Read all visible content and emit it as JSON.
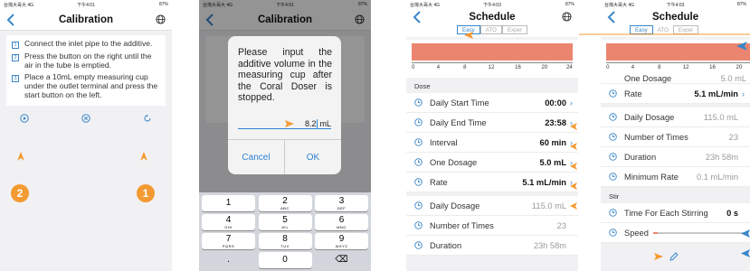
{
  "status": {
    "carrier": "台灣大哥大 4G",
    "battery": "87%"
  },
  "phone1": {
    "time": "下午4:01",
    "title": "Calibration",
    "steps": [
      {
        "num": "1",
        "text": "Connect the inlet pipe to the additive."
      },
      {
        "num": "2",
        "text": "Press the button on the right until the air in the tube is emptied."
      },
      {
        "num": "3",
        "text": "Place a 10mL empty measuring cup under the outlet terminal and press the start button on the left."
      }
    ],
    "badge_left": "2",
    "badge_right": "1"
  },
  "phone2": {
    "time": "下午4:01",
    "title": "Calibration",
    "dialog_text": "Please input the additive volume in the measuring cup after the Coral Doser is stopped.",
    "input_value": "8.2",
    "input_unit": "mL",
    "cancel": "Cancel",
    "ok": "OK",
    "keys": [
      [
        {
          "d": "1",
          "l": ""
        },
        {
          "d": "2",
          "l": "ABC"
        },
        {
          "d": "3",
          "l": "DEF"
        }
      ],
      [
        {
          "d": "4",
          "l": "GHI"
        },
        {
          "d": "5",
          "l": "JKL"
        },
        {
          "d": "6",
          "l": "MNO"
        }
      ],
      [
        {
          "d": "7",
          "l": "PQRS"
        },
        {
          "d": "8",
          "l": "TUV"
        },
        {
          "d": "9",
          "l": "WXYZ"
        }
      ],
      [
        {
          "d": ".",
          "l": ""
        },
        {
          "d": "0",
          "l": ""
        },
        {
          "d": "⌫",
          "l": ""
        }
      ]
    ]
  },
  "phone3": {
    "time": "下午4:03",
    "title": "Schedule",
    "tabs": [
      "Easy",
      "ATO",
      "Exper"
    ],
    "axis": [
      "0",
      "4",
      "8",
      "12",
      "16",
      "20",
      "24"
    ],
    "section": "Dose",
    "rows": [
      {
        "label": "Daily Start Time",
        "value": "00:00"
      },
      {
        "label": "Daily End Time",
        "value": "23:58"
      },
      {
        "label": "Interval",
        "value": "60 min"
      },
      {
        "label": "One Dosage",
        "value": "5.0 mL"
      },
      {
        "label": "Rate",
        "value": "5.1 mL/min"
      }
    ],
    "ro_rows": [
      {
        "label": "Daily Dosage",
        "value": "115.0 mL"
      },
      {
        "label": "Number of Times",
        "value": "23"
      },
      {
        "label": "Duration",
        "value": "23h 58m"
      }
    ]
  },
  "phone4": {
    "time": "下午4:03",
    "title": "Schedule",
    "tabs": [
      "Easy",
      "ATO",
      "Exper"
    ],
    "axis": [
      "0",
      "4",
      "8",
      "12",
      "16",
      "20",
      "24"
    ],
    "partial_row": {
      "label": "One Dosage",
      "value": "5.0 mL"
    },
    "rate": {
      "label": "Rate",
      "value": "5.1 mL/min"
    },
    "ro_rows": [
      {
        "label": "Daily Dosage",
        "value": "115.0 mL"
      },
      {
        "label": "Number of Times",
        "value": "23"
      },
      {
        "label": "Duration",
        "value": "23h 58m"
      },
      {
        "label": "Minimum Rate",
        "value": "0.1 mL/min"
      }
    ],
    "stir_section": "Stir",
    "stir_time": {
      "label": "Time For Each Stirring",
      "value": "0 s"
    },
    "speed": {
      "label": "Speed",
      "level": 0.05
    }
  },
  "colors": {
    "accent": "#3a86c8",
    "orange": "#f49a32",
    "timeline": "#ec8570"
  }
}
